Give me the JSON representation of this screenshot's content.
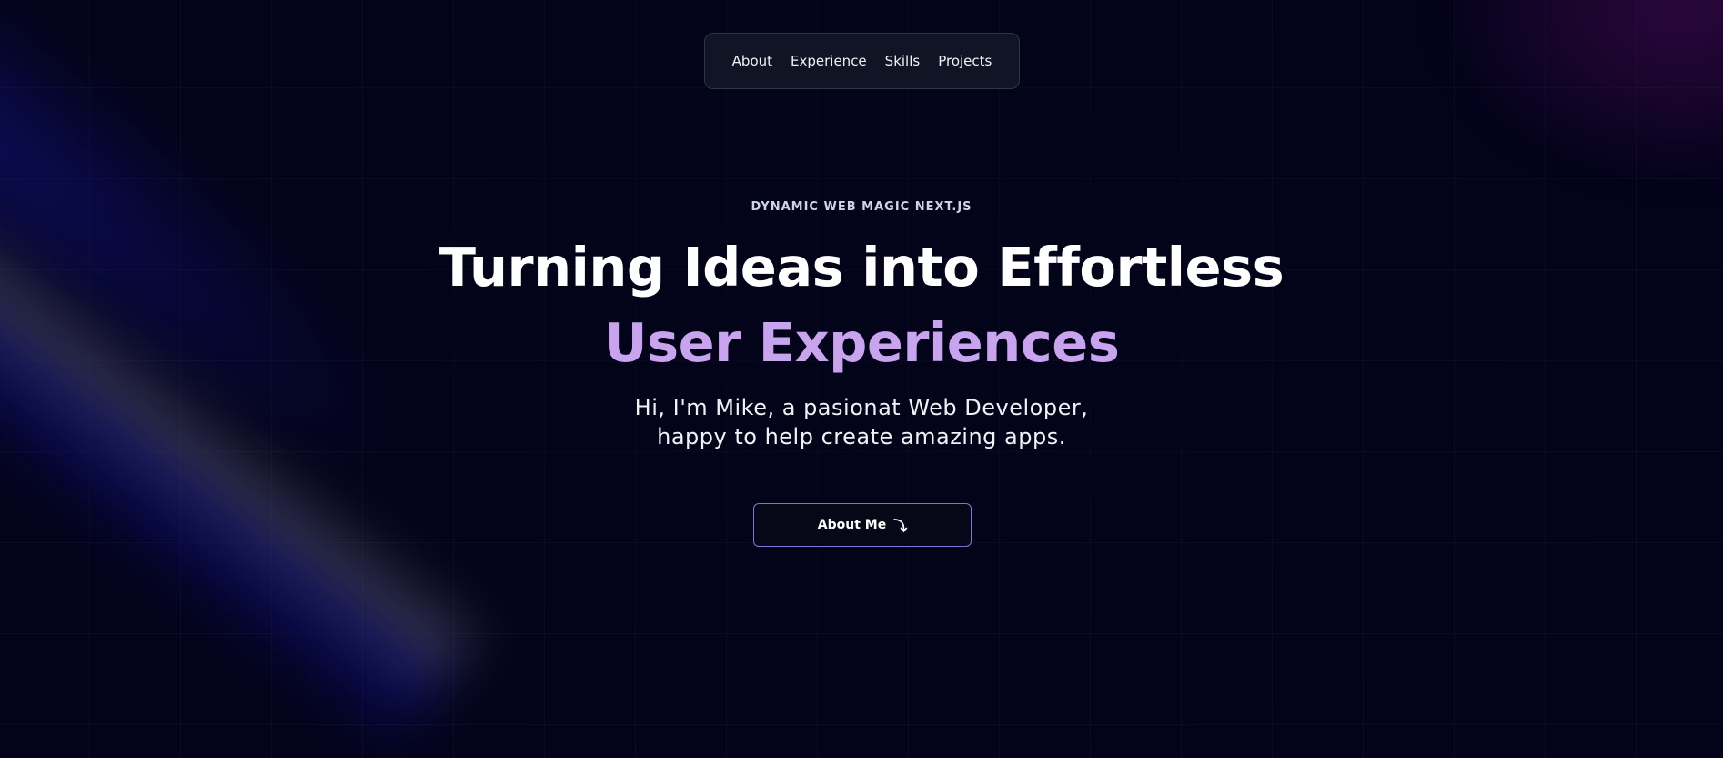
{
  "nav": {
    "items": [
      {
        "label": "About"
      },
      {
        "label": "Experience"
      },
      {
        "label": "Skills"
      },
      {
        "label": "Projects"
      }
    ]
  },
  "hero": {
    "eyebrow": "DYNAMIC WEB MAGIC NEXT.JS",
    "headline_main": "Turning Ideas into Effortless ",
    "headline_accent": "User Experiences",
    "subtitle_line1": "Hi, I'm Mike, a pasionat Web Developer,",
    "subtitle_line2": "happy to help create amazing apps.",
    "cta_label": "About Me",
    "cta_icon": "arrow-down-icon"
  },
  "colors": {
    "background": "#03031a",
    "accent": "#c8a4ee",
    "button_border": "#7a78d6"
  }
}
